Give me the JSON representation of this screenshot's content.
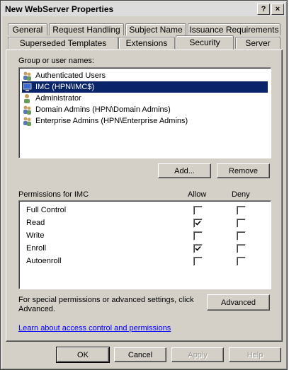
{
  "window": {
    "title": "New WebServer Properties",
    "help_glyph": "?",
    "close_glyph": "×"
  },
  "tabs_row1": [
    {
      "label": "General"
    },
    {
      "label": "Request Handling"
    },
    {
      "label": "Subject Name"
    },
    {
      "label": "Issuance Requirements"
    }
  ],
  "tabs_row2": [
    {
      "label": "Superseded Templates"
    },
    {
      "label": "Extensions"
    },
    {
      "label": "Security",
      "active": true
    },
    {
      "label": "Server"
    }
  ],
  "security": {
    "group_label": "Group or user names:",
    "users": [
      {
        "name": "Authenticated Users",
        "icon": "group-icon"
      },
      {
        "name": "IMC (HPN\\IMC$)",
        "icon": "computer-icon",
        "selected": true
      },
      {
        "name": "Administrator",
        "icon": "user-icon"
      },
      {
        "name": "Domain Admins (HPN\\Domain Admins)",
        "icon": "group-icon"
      },
      {
        "name": "Enterprise Admins (HPN\\Enterprise Admins)",
        "icon": "group-icon"
      }
    ],
    "add_button": "Add...",
    "remove_button": "Remove",
    "permissions_label": "Permissions for IMC",
    "allow_header": "Allow",
    "deny_header": "Deny",
    "permissions": [
      {
        "name": "Full Control",
        "allow": false,
        "deny": false
      },
      {
        "name": "Read",
        "allow": true,
        "deny": false
      },
      {
        "name": "Write",
        "allow": false,
        "deny": false
      },
      {
        "name": "Enroll",
        "allow": true,
        "deny": false
      },
      {
        "name": "Autoenroll",
        "allow": false,
        "deny": false
      }
    ],
    "special_text_line1": "For special permissions or advanced settings, click",
    "special_text_line2": "Advanced.",
    "advanced_button": "Advanced",
    "learn_link": "Learn about access control and permissions"
  },
  "footer": {
    "ok": "OK",
    "cancel": "Cancel",
    "apply": "Apply",
    "help": "Help"
  },
  "colors": {
    "selection": "#0a246a",
    "face": "#d4d0c8",
    "link": "#0000ff"
  }
}
